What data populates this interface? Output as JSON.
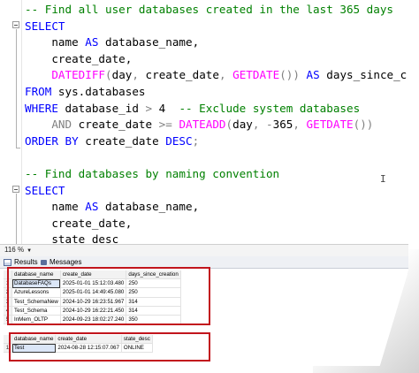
{
  "editor": {
    "lines": [
      [
        {
          "t": "-- Find all user databases created in the last 365 days",
          "c": "cm"
        }
      ],
      [
        {
          "t": "SELECT",
          "c": "kw"
        }
      ],
      [
        {
          "t": "    name ",
          "c": "tx"
        },
        {
          "t": "AS",
          "c": "kw"
        },
        {
          "t": " database_name,",
          "c": "tx"
        }
      ],
      [
        {
          "t": "    create_date,",
          "c": "tx"
        }
      ],
      [
        {
          "t": "    ",
          "c": "tx"
        },
        {
          "t": "DATEDIFF",
          "c": "fn"
        },
        {
          "t": "(",
          "c": "gy"
        },
        {
          "t": "day",
          "c": "tx"
        },
        {
          "t": ", ",
          "c": "gy"
        },
        {
          "t": "create_date",
          "c": "tx"
        },
        {
          "t": ", ",
          "c": "gy"
        },
        {
          "t": "GETDATE",
          "c": "fn"
        },
        {
          "t": "())",
          "c": "gy"
        },
        {
          "t": " AS ",
          "c": "kw"
        },
        {
          "t": "days_since_creation",
          "c": "tx"
        }
      ],
      [
        {
          "t": "FROM ",
          "c": "kw"
        },
        {
          "t": "sys.databases",
          "c": "tx"
        }
      ],
      [
        {
          "t": "WHERE ",
          "c": "kw"
        },
        {
          "t": "database_id ",
          "c": "tx"
        },
        {
          "t": ">",
          "c": "gy"
        },
        {
          "t": " 4  ",
          "c": "tx"
        },
        {
          "t": "-- Exclude system databases",
          "c": "cm"
        }
      ],
      [
        {
          "t": "    ",
          "c": "tx"
        },
        {
          "t": "AND",
          "c": "gy"
        },
        {
          "t": " create_date ",
          "c": "tx"
        },
        {
          "t": ">=",
          "c": "gy"
        },
        {
          "t": " ",
          "c": "tx"
        },
        {
          "t": "DATEADD",
          "c": "fn"
        },
        {
          "t": "(",
          "c": "gy"
        },
        {
          "t": "day",
          "c": "tx"
        },
        {
          "t": ", ",
          "c": "gy"
        },
        {
          "t": "-",
          "c": "gy"
        },
        {
          "t": "365",
          "c": "tx"
        },
        {
          "t": ", ",
          "c": "gy"
        },
        {
          "t": "GETDATE",
          "c": "fn"
        },
        {
          "t": "())",
          "c": "gy"
        }
      ],
      [
        {
          "t": "ORDER BY ",
          "c": "kw"
        },
        {
          "t": "create_date ",
          "c": "tx"
        },
        {
          "t": "DESC",
          "c": "kw"
        },
        {
          "t": ";",
          "c": "gy"
        }
      ],
      [
        {
          "t": "",
          "c": "tx"
        }
      ],
      [
        {
          "t": "-- Find databases by naming convention",
          "c": "cm"
        }
      ],
      [
        {
          "t": "SELECT",
          "c": "kw"
        }
      ],
      [
        {
          "t": "    name ",
          "c": "tx"
        },
        {
          "t": "AS",
          "c": "kw"
        },
        {
          "t": " database_name,",
          "c": "tx"
        }
      ],
      [
        {
          "t": "    create_date,",
          "c": "tx"
        }
      ],
      [
        {
          "t": "    state_desc",
          "c": "tx"
        }
      ],
      [
        {
          "t": "FROM ",
          "c": "kw"
        },
        {
          "t": "sys.databases",
          "c": "tx"
        }
      ],
      [
        {
          "t": "WHERE ",
          "c": "kw"
        },
        {
          "t": "name ",
          "c": "tx"
        },
        {
          "t": "LIKE ",
          "c": "gy"
        },
        {
          "t": "'Test'",
          "c": "st"
        }
      ],
      [
        {
          "t": "    ",
          "c": "tx"
        },
        {
          "t": "OR",
          "c": "gy"
        },
        {
          "t": " name ",
          "c": "tx"
        },
        {
          "t": "LIKE ",
          "c": "gy"
        },
        {
          "t": "'Dev_%'",
          "c": "st"
        }
      ]
    ]
  },
  "status": {
    "zoom": "116 %"
  },
  "tabs": {
    "results": "Results",
    "messages": "Messages"
  },
  "grid1": {
    "columns": [
      "database_name",
      "create_date",
      "days_since_creation"
    ],
    "rows": [
      [
        "1",
        "DatabaseFAQs",
        "2025-01-01 15:12:03.480",
        "250"
      ],
      [
        "2",
        "AzureLessons",
        "2025-01-01 14:49:45.080",
        "250"
      ],
      [
        "3",
        "Test_SchemaNew",
        "2024-10-29 16:23:51.967",
        "314"
      ],
      [
        "4",
        "Test_Schema",
        "2024-10-29 16:22:21.450",
        "314"
      ],
      [
        "5",
        "InMem_OLTP",
        "2024-09-23 18:02:27.240",
        "350"
      ]
    ]
  },
  "grid2": {
    "columns": [
      "database_name",
      "create_date",
      "state_desc"
    ],
    "rows": [
      [
        "1",
        "Test",
        "2024-08-28 12:15:07.067",
        "ONLINE"
      ]
    ]
  },
  "colors": {
    "highlight": "#c2151d",
    "keyword": "#0000ff",
    "function": "#ff00ff",
    "comment": "#008000",
    "string": "#ff0000"
  }
}
